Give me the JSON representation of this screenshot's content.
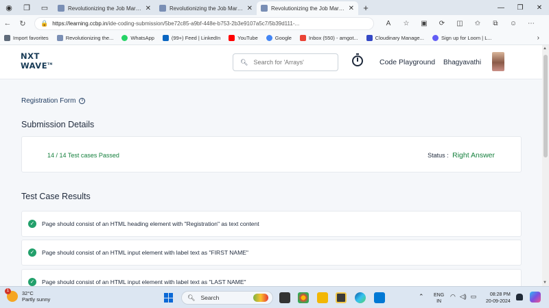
{
  "browser": {
    "tabs": [
      {
        "title": "Revolutionizing the Job Market | N",
        "active": false
      },
      {
        "title": "Revolutionizing the Job Market | N",
        "active": false
      },
      {
        "title": "Revolutionizing the Job Market | N",
        "active": true
      }
    ],
    "url_host": "https://learning.ccbp.in",
    "url_path": "/ide-coding-submission/5be72c85-a9bf-448e-b753-2b3e9107a5c7/5b39d111-...",
    "bookmarks": [
      {
        "label": "Import favorites",
        "color": "#5f6b7a"
      },
      {
        "label": "Revolutionizing the...",
        "color": "#7a8fb5"
      },
      {
        "label": "WhatsApp",
        "color": "#25d366"
      },
      {
        "label": "(99+) Feed | LinkedIn",
        "color": "#0a66c2"
      },
      {
        "label": "YouTube",
        "color": "#ff0000"
      },
      {
        "label": "Google",
        "color": "#4285f4"
      },
      {
        "label": "Inbox (550) - amgot...",
        "color": "#ea4335"
      },
      {
        "label": "Cloudinary Manage...",
        "color": "#3448c5"
      },
      {
        "label": "Sign up for Loom | L...",
        "color": "#625df5"
      }
    ]
  },
  "header": {
    "logo_line1": "NXT",
    "logo_line2": "WAVE",
    "logo_tm": "TM",
    "search_placeholder": "Search for 'Arrays'",
    "code_playground": "Code Playground",
    "user_name": "Bhagyavathi"
  },
  "main": {
    "form_title": "Registration Form",
    "submission_heading": "Submission Details",
    "tests_passed": "14 / 14 Test cases Passed",
    "status_label": "Status :",
    "status_value": "Right Answer",
    "results_heading": "Test Case Results",
    "results": [
      "Page should consist of an HTML heading element with \"Registration\" as text content",
      "Page should consist of an HTML input element with label text as \"FIRST NAME\"",
      "Page should consist of an HTML input element with label text as \"LAST NAME\""
    ]
  },
  "taskbar": {
    "weather_temp": "32°C",
    "weather_desc": "Partly sunny",
    "weather_badge": "1",
    "search_label": "Search",
    "lang_line1": "ENG",
    "lang_line2": "IN",
    "time": "08:28 PM",
    "date": "20-09-2024"
  },
  "colors": {
    "accent_green": "#15803d",
    "brand_navy": "#183b56"
  }
}
